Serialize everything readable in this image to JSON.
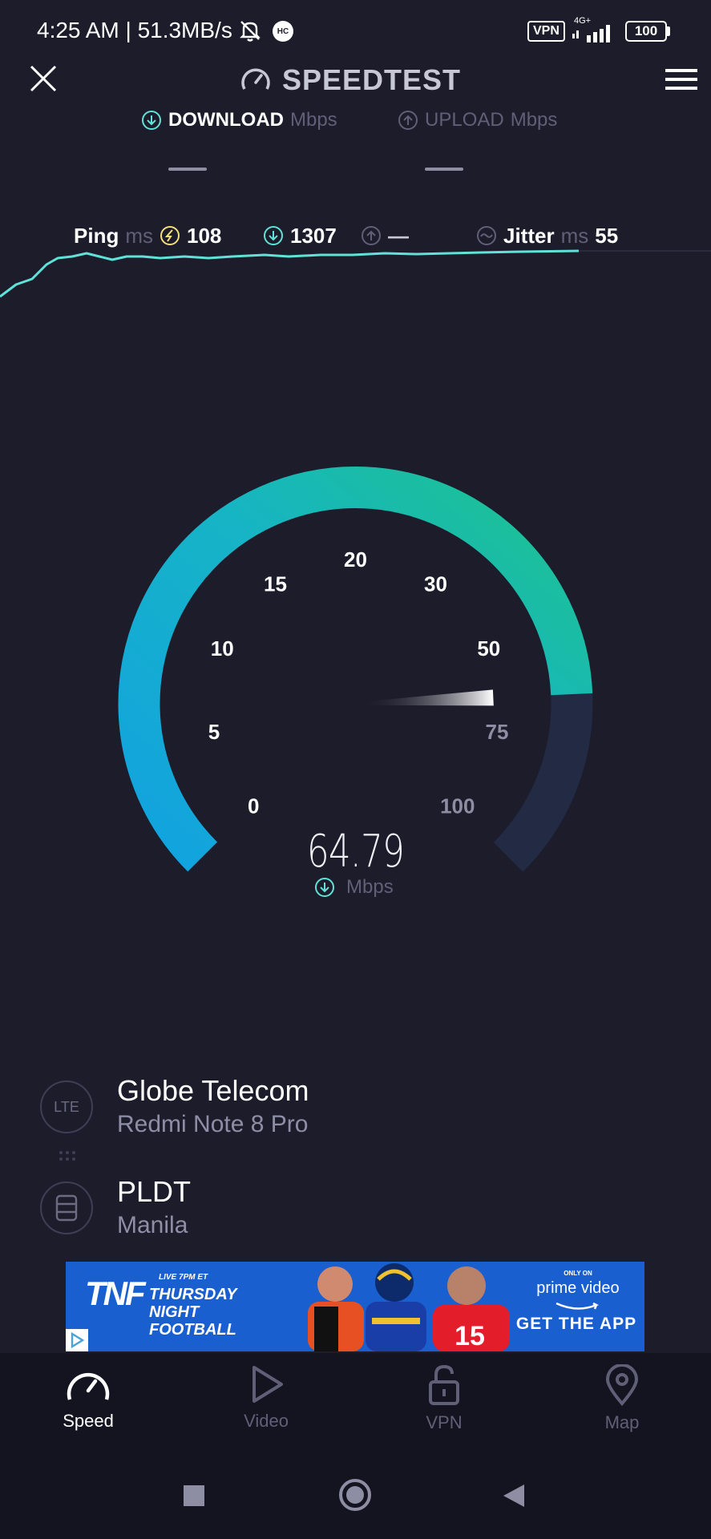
{
  "status_bar": {
    "time": "4:25 AM | 51.3MB/s",
    "hc_label": "HC",
    "vpn_label": "VPN",
    "network": "4G+",
    "battery": "100"
  },
  "header": {
    "title": "SPEEDTEST",
    "download_label": "DOWNLOAD",
    "upload_label": "UPLOAD",
    "unit": "Mbps"
  },
  "stats": {
    "ping_label": "Ping",
    "ping_unit": "ms",
    "ping_value": "108",
    "download_value": "1307",
    "upload_value": "—",
    "jitter_label": "Jitter",
    "jitter_unit": "ms",
    "jitter_value": "55"
  },
  "gauge": {
    "ticks": [
      "0",
      "5",
      "10",
      "15",
      "20",
      "30",
      "50",
      "75",
      "100"
    ],
    "value": "64.79",
    "unit": "Mbps",
    "current_speed": 64.79
  },
  "provider": {
    "icon_label": "LTE",
    "name": "Globe Telecom",
    "device": "Redmi Note 8 Pro"
  },
  "server": {
    "name": "PLDT",
    "location": "Manila"
  },
  "ad": {
    "brand": "TNF",
    "live_text": "LIVE 7PM ET",
    "line1": "THURSDAY",
    "line2": "NIGHT",
    "line3": "FOOTBALL",
    "only_on": "ONLY ON",
    "prime": "prime video",
    "cta": "GET THE APP"
  },
  "nav": {
    "items": [
      {
        "label": "Speed",
        "active": true
      },
      {
        "label": "Video",
        "active": false
      },
      {
        "label": "VPN",
        "active": false
      },
      {
        "label": "Map",
        "active": false
      }
    ]
  },
  "colors": {
    "background": "#1c1c2b",
    "accent_cyan": "#5fe3d8",
    "gauge_blue": "#13a6e0",
    "gauge_green": "#1ec08f",
    "ping_yellow": "#f4e07a",
    "muted": "#5f6078"
  }
}
